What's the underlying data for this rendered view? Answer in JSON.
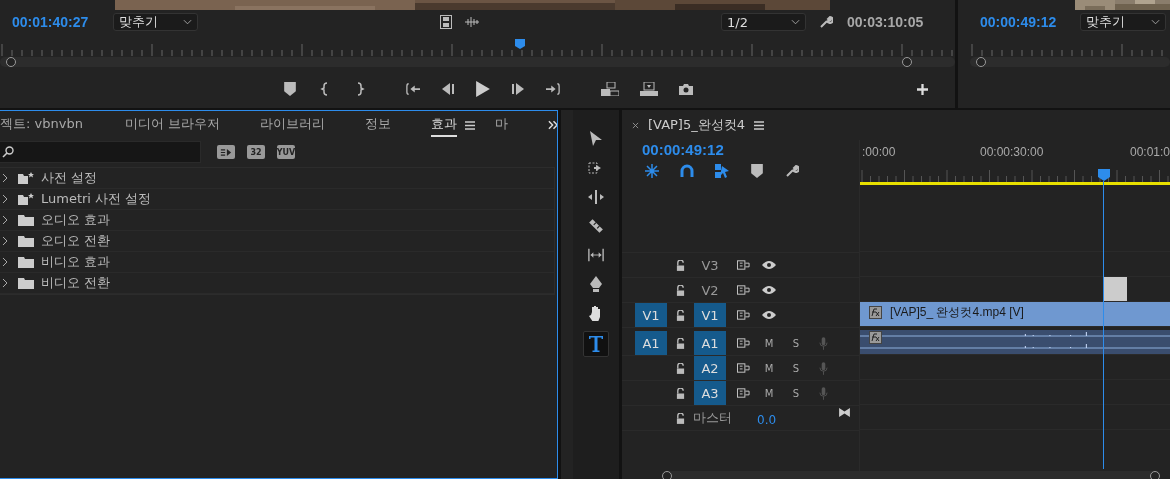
{
  "program_monitor": {
    "timecode": "00:01:40:27",
    "zoom": "맞추기",
    "quality": "1/2",
    "duration": "00:03:10:05",
    "level": 0.545
  },
  "source_monitor": {
    "timecode": "00:00:49:12",
    "zoom": "맞추기"
  },
  "effects_panel": {
    "tabs": [
      {
        "label": "젝트: vbnvbn",
        "selected": false
      },
      {
        "label": "미디어 브라우저",
        "selected": false
      },
      {
        "label": "라이브러리",
        "selected": false
      },
      {
        "label": "정보",
        "selected": false
      },
      {
        "label": "효과",
        "selected": true
      },
      {
        "label": "마",
        "selected": false
      }
    ],
    "filter_buttons": [
      {
        "kind": "accelerated"
      },
      {
        "kind": "bit32",
        "label": "32"
      },
      {
        "kind": "yuv",
        "label": "YUV"
      }
    ],
    "items": [
      {
        "kind": "preset",
        "label": "사전 설정"
      },
      {
        "kind": "preset",
        "label": "Lumetri 사전 설정"
      },
      {
        "kind": "folder",
        "label": "오디오 효과"
      },
      {
        "kind": "folder",
        "label": "오디오 전환"
      },
      {
        "kind": "folder",
        "label": "비디오 효과"
      },
      {
        "kind": "folder",
        "label": "비디오 전환"
      }
    ]
  },
  "tools": [
    {
      "kind": "select",
      "selected": false
    },
    {
      "kind": "track-select",
      "selected": false
    },
    {
      "kind": "ripple",
      "selected": false
    },
    {
      "kind": "razor",
      "selected": false
    },
    {
      "kind": "slip",
      "selected": false
    },
    {
      "kind": "pen",
      "selected": false
    },
    {
      "kind": "hand",
      "selected": false
    },
    {
      "kind": "type",
      "selected": true
    }
  ],
  "timeline": {
    "title": "[VAP]5_완성컷4",
    "timecode": "00:00:49:12",
    "level": 0.784,
    "ruler_labels": [
      ":00:00",
      "00:00:30:00",
      "00:01:0"
    ],
    "tracks": [
      {
        "kind": "video",
        "label": "V3",
        "targeted": false
      },
      {
        "kind": "video",
        "label": "V2",
        "targeted": false,
        "clip": {
          "kind": "still"
        }
      },
      {
        "kind": "video",
        "label": "V1",
        "source": "V1",
        "targeted": true,
        "clip": {
          "kind": "video",
          "label": "[VAP]5_ 완성컷4.mp4 [V]"
        }
      },
      {
        "kind": "audio",
        "label": "A1",
        "source": "A1",
        "targeted": true,
        "mute": "M",
        "solo": "S",
        "clip": {
          "kind": "audio"
        }
      },
      {
        "kind": "audio",
        "label": "A2",
        "targeted": true,
        "mute": "M",
        "solo": "S"
      },
      {
        "kind": "audio",
        "label": "A3",
        "targeted": true,
        "mute": "M",
        "solo": "S"
      }
    ],
    "master": {
      "label": "마스터",
      "value": "0.0"
    }
  }
}
